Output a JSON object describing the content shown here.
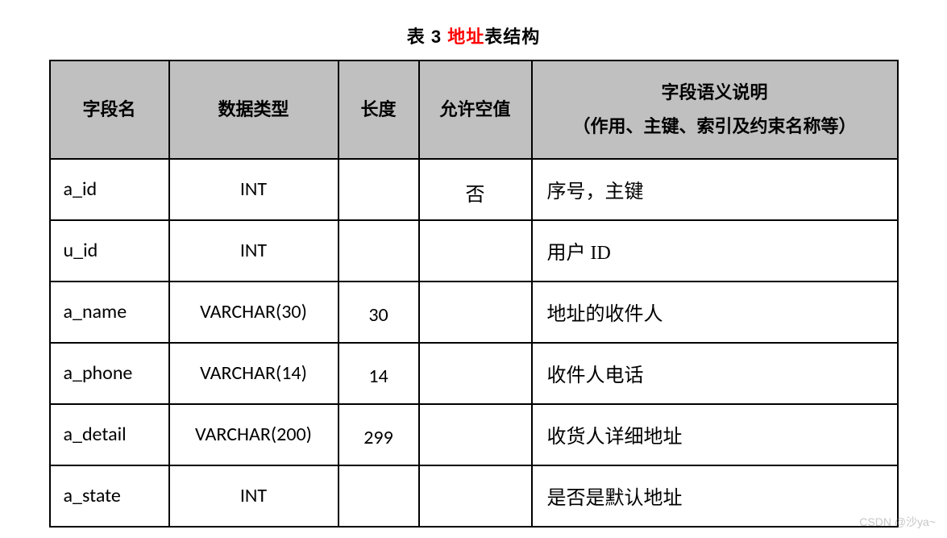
{
  "caption": {
    "prefix": "表 3 ",
    "highlight": "地址",
    "suffix": "表结构"
  },
  "headers": {
    "field": "字段名",
    "type": "数据类型",
    "length": "长度",
    "nullable": "允许空值",
    "desc_line1": "字段语义说明",
    "desc_line2": "（作用、主键、索引及约束名称等）"
  },
  "rows": [
    {
      "field": "a_id",
      "type": "INT",
      "length": "",
      "nullable": "否",
      "desc": "序号，主键"
    },
    {
      "field": "u_id",
      "type": "INT",
      "length": "",
      "nullable": "",
      "desc": "用户 ID"
    },
    {
      "field": "a_name",
      "type": "VARCHAR(30)",
      "length": "30",
      "nullable": "",
      "desc": "地址的收件人"
    },
    {
      "field": "a_phone",
      "type": "VARCHAR(14)",
      "length": "14",
      "nullable": "",
      "desc": "收件人电话"
    },
    {
      "field": "a_detail",
      "type": "VARCHAR(200)",
      "length": "299",
      "nullable": "",
      "desc": "收货人详细地址"
    },
    {
      "field": "a_state",
      "type": "INT",
      "length": "",
      "nullable": "",
      "desc": "是否是默认地址"
    }
  ],
  "watermark": "CSDN @沙ya~"
}
